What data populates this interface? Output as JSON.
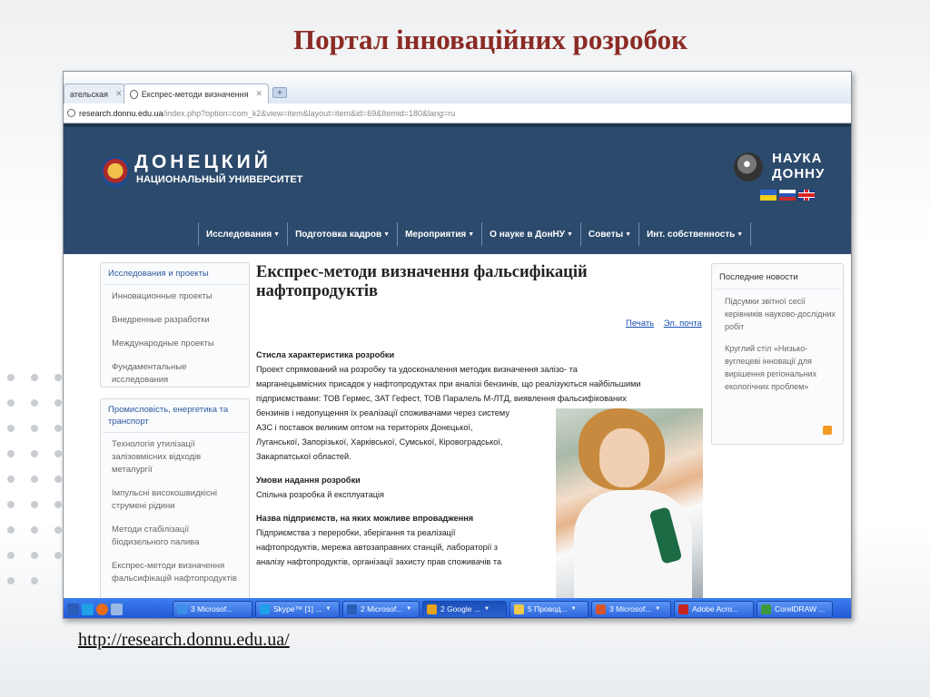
{
  "slide": {
    "title": "Портал інноваційних розробок",
    "url_caption": "http://research.donnu.edu.ua/"
  },
  "browser": {
    "tabs": [
      {
        "label": "ательская",
        "active": false
      },
      {
        "label": "Експрес-методи визначення",
        "active": true
      }
    ],
    "address": {
      "host": "research.donnu.edu.ua",
      "path": "/index.php?option=com_k2&view=item&layout=item&id=69&Itemid=180&lang=ru"
    }
  },
  "site": {
    "logo_title": "ДОНЕЦКИЙ",
    "logo_subtitle": "НАЦИОНАЛЬНЫЙ УНИВЕРСИТЕТ",
    "partner_line1": "НАУКА",
    "partner_line2": "ДОННУ",
    "nav": [
      "Исследования",
      "Подготовка кадров",
      "Мероприятия",
      "О науке в ДонНУ",
      "Советы",
      "Инт. собственность"
    ]
  },
  "sidebar": {
    "box1": {
      "title": "Исследования и проекты",
      "items": [
        "Инновационные проекты",
        "Внедренные разработки",
        "Международные проекты",
        "Фундаментальные исследования"
      ]
    },
    "box2": {
      "title": "Промисловість, енергетика та транспорт",
      "items": [
        "Технологія утилізації залізовмісних відходів металургії",
        "Імпульсні високошвидкісні струмені рідини",
        "Методи стабілізації біодизельного палива",
        "Експрес-методи визначення фальсифікацій нафтопродуктів"
      ]
    }
  },
  "article": {
    "title": "Експрес-методи визначення фальсифікацій нафтопродуктів",
    "print_link": "Печать",
    "email_link": "Эл. почта",
    "section1_heading": "Стисла характеристика розробки",
    "section1_lines": [
      "Проект спрямований на розробку та удосконалення методик визначення залізо- та",
      "марганецьвмісних присадок у нафтопродуктах при аналізі бензинів, що реалізуються найбільшими",
      "підприємствами: ТОВ Гермес, ЗАТ Гефест, ТОВ Паралель М-ЛТД, виявлення фальсифікованих",
      "бензинів і недопущення їх реалізації споживачами через систему",
      "АЗС і поставок великим оптом на територіях Донецької,",
      "Луганської, Запорізької, Харківської, Сумської, Кіровоградської,",
      "Закарпатської областей."
    ],
    "section2_heading": "Умови надання розробки",
    "section2_text": "Спільна розробка й експлуатація",
    "section3_heading": "Назва підприємств, на яких можливе впровадження",
    "section3_lines": [
      "Підприємства з переробки, зберігання та реалізації",
      "нафтопродуктів, мережа автозаправних станцій, лабораторії з",
      "аналізу нафтопродуктів, організації захисту прав споживачів та"
    ]
  },
  "news": {
    "title": "Последние новости",
    "items": [
      "Підсумки звітної сесії керівників науково-дослідних робіт",
      "Круглий стіл «Низько-вуглецеві інновації для вирішення регіональних екологічних проблем»"
    ]
  },
  "taskbar": {
    "buttons": [
      {
        "label": "3 Microsof...",
        "color": "#3a8ee6"
      },
      {
        "label": "Skype™ [1] ...",
        "color": "#1fa0e6"
      },
      {
        "label": "2 Microsof...",
        "color": "#2b5cb8"
      },
      {
        "label": "2 Google ...",
        "color": "#e9a21b"
      },
      {
        "label": "5 Провод...",
        "color": "#f0c84a"
      },
      {
        "label": "3 Microsof...",
        "color": "#d6552b"
      },
      {
        "label": "Adobe Acro...",
        "color": "#c8241e"
      },
      {
        "label": "CorelDRAW ...",
        "color": "#3c9a3c"
      }
    ]
  },
  "colors": {
    "slide_title": "#8c2a24",
    "site_header": "#2b4a6c",
    "link": "#1a4fb2"
  }
}
